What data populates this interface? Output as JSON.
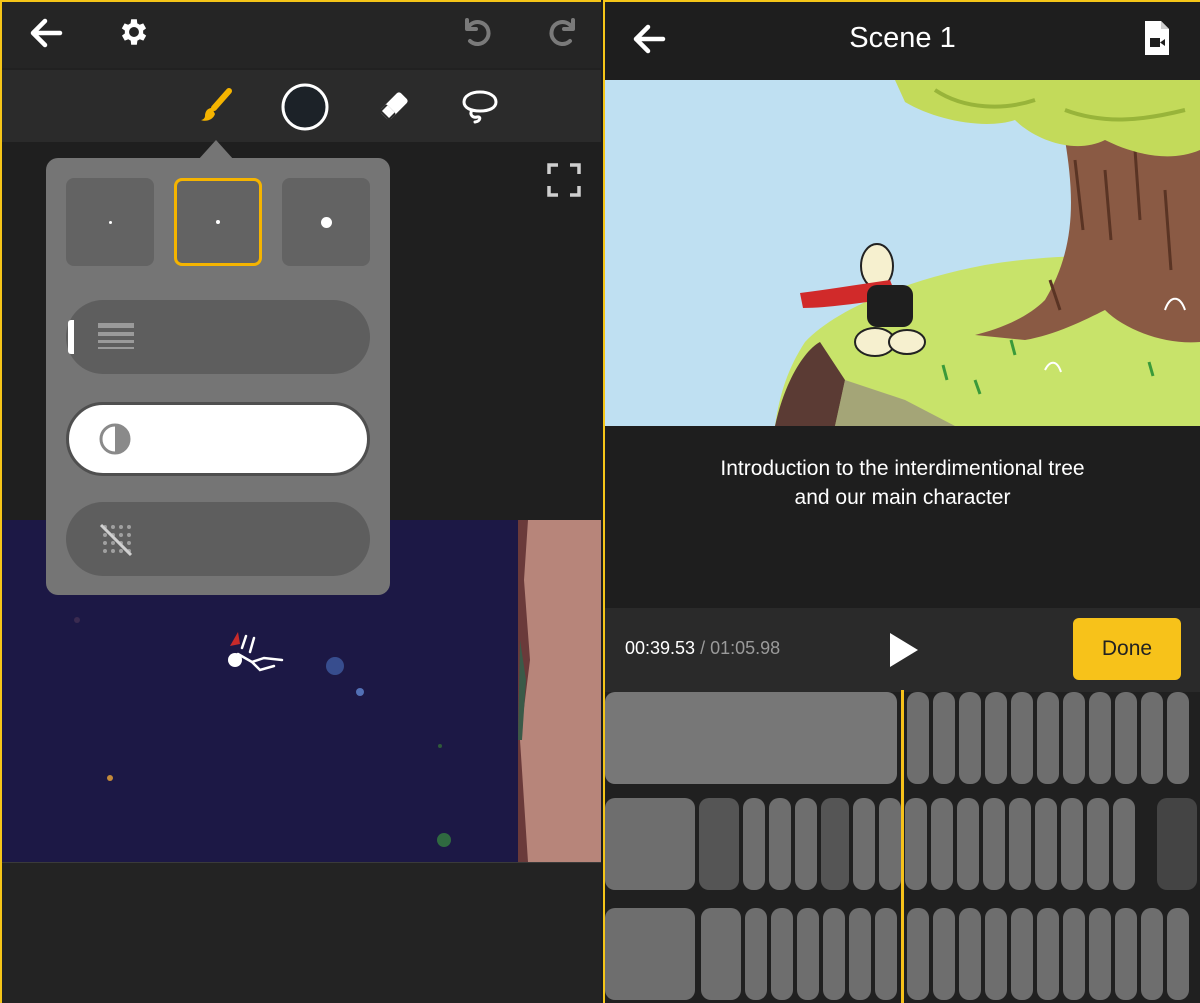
{
  "left_editor": {
    "top_icons": [
      "back-arrow-icon",
      "gear-icon",
      "undo-icon",
      "redo-icon"
    ],
    "tools": [
      "brush-icon",
      "color-circle-icon",
      "eraser-icon",
      "lasso-icon"
    ],
    "active_tool_color": "#f5b400",
    "brush_sizes": [
      "small",
      "medium",
      "large"
    ],
    "selected_size": "medium",
    "popup_sliders": [
      "thickness-icon",
      "opacity-icon",
      "texture-off-icon"
    ]
  },
  "right_editor": {
    "title": "Scene 1",
    "caption_line1": "Introduction to the interdimentional tree",
    "caption_line2": "and our main character",
    "time_current": "00:39.53",
    "time_separator": " / ",
    "time_total": "01:05.98",
    "done_label": "Done",
    "accent": "#f7c21a"
  }
}
